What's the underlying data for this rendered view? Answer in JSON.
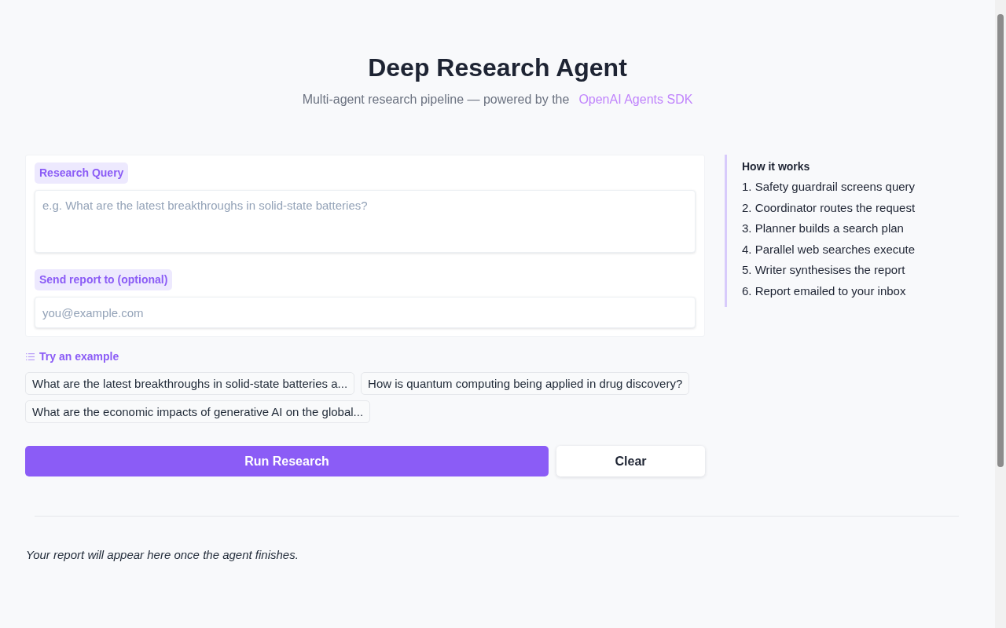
{
  "header": {
    "title": "Deep Research Agent",
    "subtitle": "Multi-agent research pipeline — powered by the",
    "link": "OpenAI Agents SDK"
  },
  "form": {
    "fields": [
      {
        "kind": "textarea",
        "label": "Research Query",
        "placeholder": "e.g. What are the latest breakthroughs in solid-state batteries?"
      },
      {
        "kind": "email",
        "label": "Send report to (optional)",
        "placeholder": "you@example.com"
      }
    ]
  },
  "examples": {
    "heading": "Try an example",
    "items": [
      "What are the latest breakthroughs in solid-state batteries a...",
      "How is quantum computing being applied in drug discovery?",
      "What are the economic impacts of generative AI on the global..."
    ]
  },
  "buttons": [
    {
      "label": "Run Research",
      "kind": "primary"
    },
    {
      "label": "Clear",
      "kind": "secondary"
    }
  ],
  "report": {
    "message": "Your report will appear here once the agent finishes."
  },
  "how_it_works": {
    "title": "How it works",
    "steps": [
      "1. Safety guardrail screens query",
      "2. Coordinator routes the request",
      "3. Planner builds a search plan",
      "4. Parallel web searches execute",
      "5. Writer synthesises the report",
      "6. Report emailed to your inbox"
    ]
  }
}
